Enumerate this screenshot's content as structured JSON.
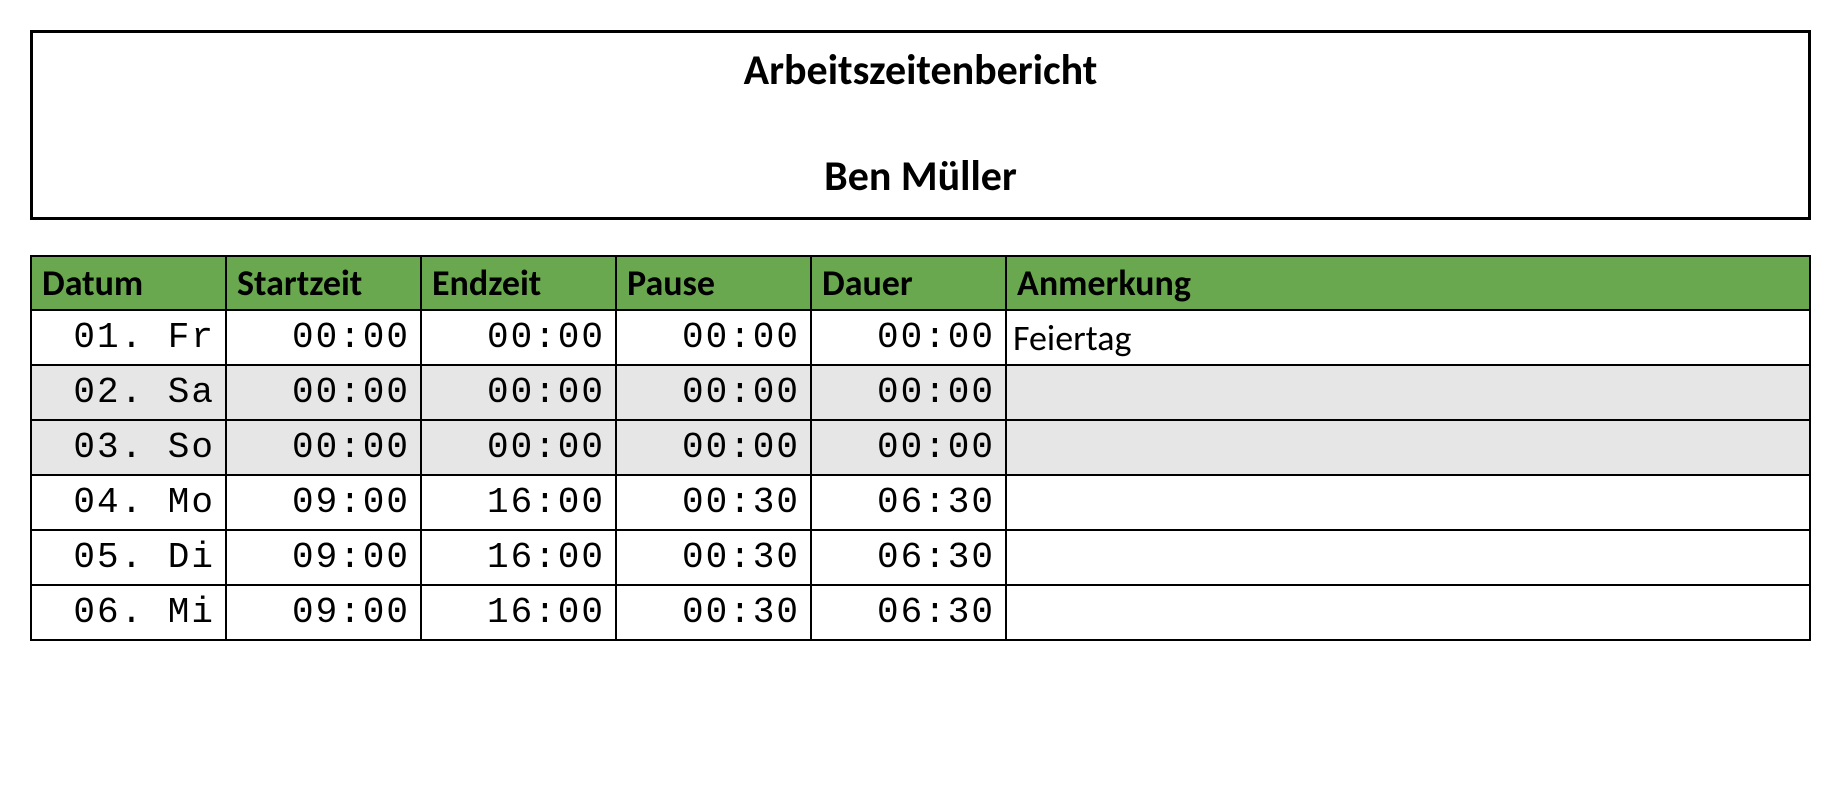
{
  "header": {
    "title": "Arbeitszeitenbericht",
    "name": "Ben Müller"
  },
  "columns": {
    "datum": "Datum",
    "start": "Startzeit",
    "end": "Endzeit",
    "pause": "Pause",
    "dauer": "Dauer",
    "anmerkung": "Anmerkung"
  },
  "rows": [
    {
      "datum": "01. Fr",
      "start": "00:00",
      "end": "00:00",
      "pause": "00:00",
      "dauer": "00:00",
      "anmerkung": "Feiertag",
      "shaded": false
    },
    {
      "datum": "02. Sa",
      "start": "00:00",
      "end": "00:00",
      "pause": "00:00",
      "dauer": "00:00",
      "anmerkung": "",
      "shaded": true
    },
    {
      "datum": "03. So",
      "start": "00:00",
      "end": "00:00",
      "pause": "00:00",
      "dauer": "00:00",
      "anmerkung": "",
      "shaded": true
    },
    {
      "datum": "04. Mo",
      "start": "09:00",
      "end": "16:00",
      "pause": "00:30",
      "dauer": "06:30",
      "anmerkung": "",
      "shaded": false
    },
    {
      "datum": "05. Di",
      "start": "09:00",
      "end": "16:00",
      "pause": "00:30",
      "dauer": "06:30",
      "anmerkung": "",
      "shaded": false
    },
    {
      "datum": "06. Mi",
      "start": "09:00",
      "end": "16:00",
      "pause": "00:30",
      "dauer": "06:30",
      "anmerkung": "",
      "shaded": false
    }
  ]
}
